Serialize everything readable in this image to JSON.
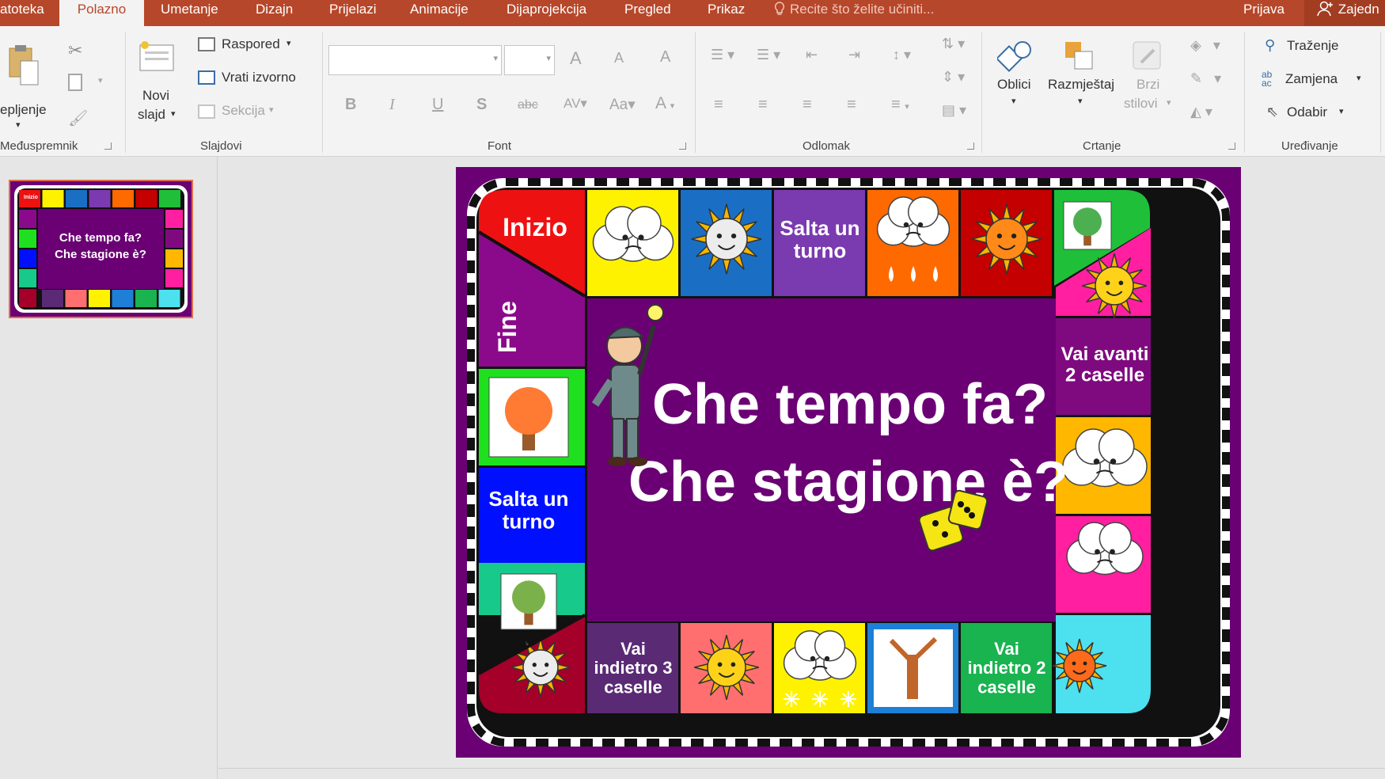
{
  "tabs": [
    {
      "label": "atoteka",
      "active": false
    },
    {
      "label": "Polazno",
      "active": true
    },
    {
      "label": "Umetanje",
      "active": false
    },
    {
      "label": "Dizajn",
      "active": false
    },
    {
      "label": "Prijelazi",
      "active": false
    },
    {
      "label": "Animacije",
      "active": false
    },
    {
      "label": "Dijaprojekcija",
      "active": false
    },
    {
      "label": "Pregled",
      "active": false
    },
    {
      "label": "Prikaz",
      "active": false
    }
  ],
  "tell_me": "Recite što želite učiniti...",
  "account": {
    "signin": "Prijava",
    "share": "Zajedn"
  },
  "ribbon": {
    "clipboard": {
      "paste": "epljenje",
      "group": "Međuspremnik"
    },
    "slides": {
      "new_slide_1": "Novi",
      "new_slide_2": "slajd",
      "layout": "Raspored",
      "reset": "Vrati izvorno",
      "section": "Sekcija",
      "group": "Slajdovi"
    },
    "font": {
      "group": "Font"
    },
    "paragraph": {
      "group": "Odlomak"
    },
    "drawing": {
      "shapes": "Oblici",
      "arrange": "Razmještaj",
      "quick_1": "Brzi",
      "quick_2": "stilovi",
      "group": "Crtanje"
    },
    "editing": {
      "find": "Traženje",
      "replace": "Zamjena",
      "select": "Odabir",
      "group": "Uređivanje"
    }
  },
  "slide": {
    "title_line1": "Che tempo fa?",
    "title_line2": "Che stagione è?",
    "start": "Inizio",
    "end": "Fine",
    "top": [
      "Salta un turno"
    ],
    "right": [
      "Vai avanti 2 caselle"
    ],
    "left": [
      "Salta un turno"
    ],
    "bottom": [
      "Vai indietro 3 caselle",
      "Vai indietro 2 caselle"
    ]
  },
  "thumbnail": {
    "title_line1": "Che tempo fa?",
    "title_line2": "Che stagione è?",
    "start": "Inizio",
    "end": "Fine"
  },
  "colors": {
    "accent": "#b7472a",
    "slide_bg": "#6b0074"
  }
}
